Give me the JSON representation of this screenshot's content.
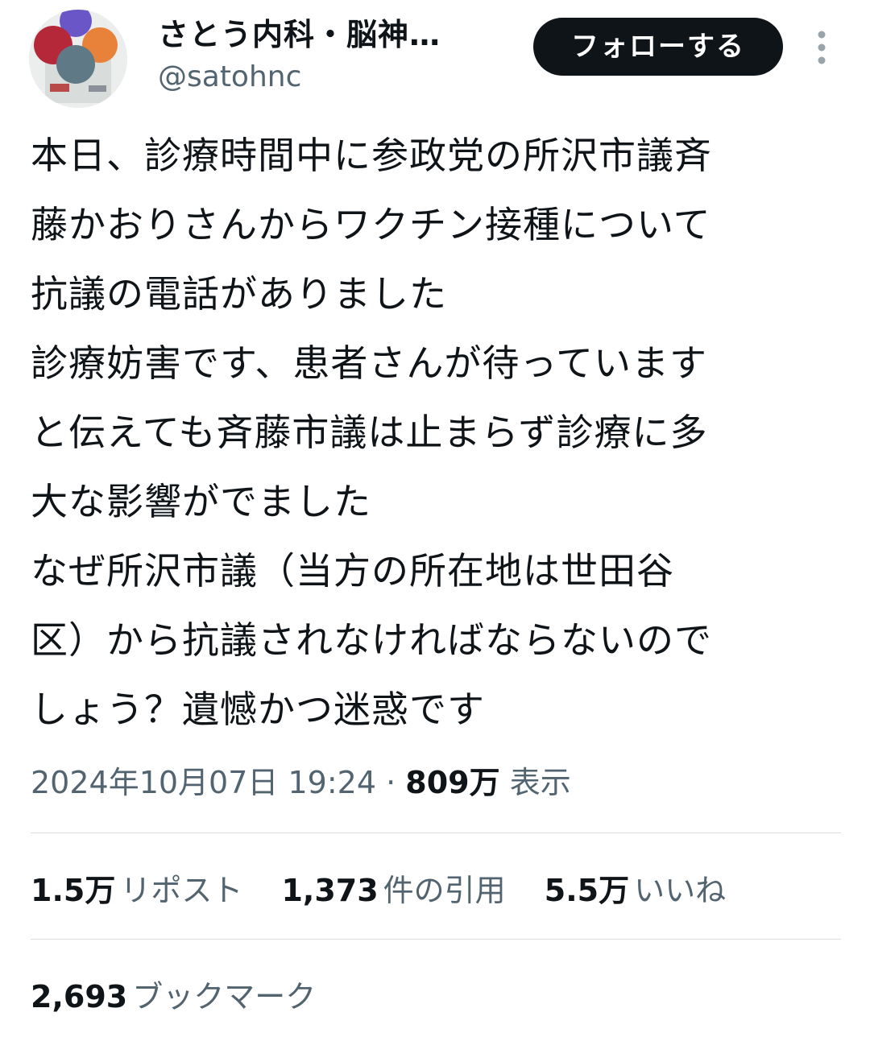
{
  "user": {
    "display_name": "さとう内科・脳神…",
    "handle": "@satohnc",
    "follow_label": "フォローする"
  },
  "icons": {
    "avatar": "avatar-vial-caps",
    "more": "more-vertical-icon"
  },
  "tweet": {
    "lines": [
      "本日、診療時間中に参政党の所沢市議斉",
      "藤かおりさんからワクチン接種について",
      "抗議の電話がありました",
      "診療妨害です、患者さんが待っています",
      "と伝えても斉藤市議は止まらず診療に多",
      "大な影響がでました",
      "なぜ所沢市議（当方の所在地は世田谷",
      "区）から抗議されなければならないので",
      "しょう？遺憾かつ迷惑です"
    ]
  },
  "meta": {
    "timestamp": "2024年10月07日 19:24",
    "separator": " · ",
    "views_count": "809万",
    "views_label": "表示"
  },
  "stats": {
    "reposts": {
      "count": "1.5万",
      "label": "リポスト"
    },
    "quotes": {
      "count": "1,373",
      "label": "件の引用"
    },
    "likes": {
      "count": "5.5万",
      "label": "いいね"
    },
    "bookmarks": {
      "count": "2,693",
      "label": "ブックマーク"
    }
  },
  "colors": {
    "text_primary": "#0f1419",
    "text_secondary": "#536471",
    "follow_bg": "#0f1419",
    "divider": "#d9dde0"
  }
}
